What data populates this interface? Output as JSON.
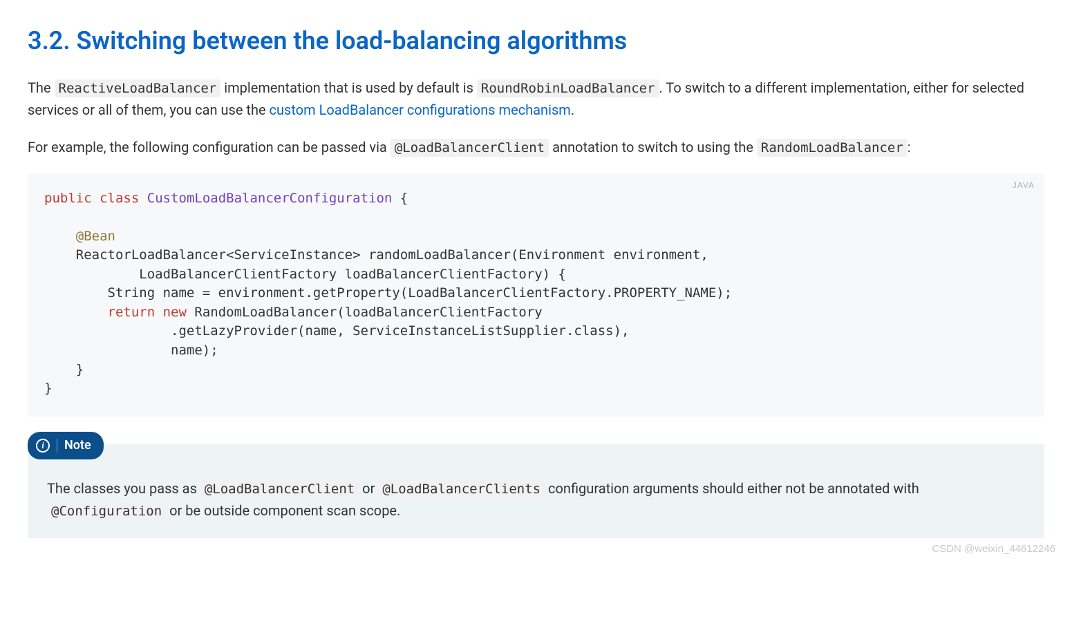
{
  "heading": "3.2. Switching between the load-balancing algorithms",
  "para1": {
    "t1": "The ",
    "c1": "ReactiveLoadBalancer",
    "t2": " implementation that is used by default is ",
    "c2": "RoundRobinLoadBalancer",
    "t3": ". To switch to a different implementation, either for selected services or all of them, you can use the ",
    "link": "custom LoadBalancer configurations mechanism",
    "t4": "."
  },
  "para2": {
    "t1": "For example, the following configuration can be passed via ",
    "c1": "@LoadBalancerClient",
    "t2": " annotation to switch to using the ",
    "c2": "RandomLoadBalancer",
    "t3": ":"
  },
  "code": {
    "lang": "JAVA",
    "kw_public": "public",
    "kw_class": "class",
    "clsname": "CustomLoadBalancerConfiguration",
    "brace_open": " {",
    "blank": "",
    "l_bean_indent": "    ",
    "ann_bean": "@Bean",
    "l_sig": "    ReactorLoadBalancer<ServiceInstance> randomLoadBalancer(Environment environment,",
    "l_sig2": "            LoadBalancerClientFactory loadBalancerClientFactory) {",
    "l_name": "        String name = environment.getProperty(LoadBalancerClientFactory.PROPERTY_NAME);",
    "l_ret_indent": "        ",
    "kw_return": "return",
    "kw_new": "new",
    "l_ret_tail": " RandomLoadBalancer(loadBalancerClientFactory",
    "l_lazy": "                .getLazyProvider(name, ServiceInstanceListSupplier.class),",
    "l_namearg": "                name);",
    "l_close1": "    }",
    "l_close2": "}"
  },
  "note": {
    "label": "Note",
    "t1": "The classes you pass as ",
    "c1": "@LoadBalancerClient",
    "t2": " or ",
    "c2": "@LoadBalancerClients",
    "t3": " configuration arguments should either not be annotated with ",
    "c3": "@Configuration",
    "t4": " or be outside component scan scope."
  },
  "watermark": "CSDN @weixin_44612246"
}
